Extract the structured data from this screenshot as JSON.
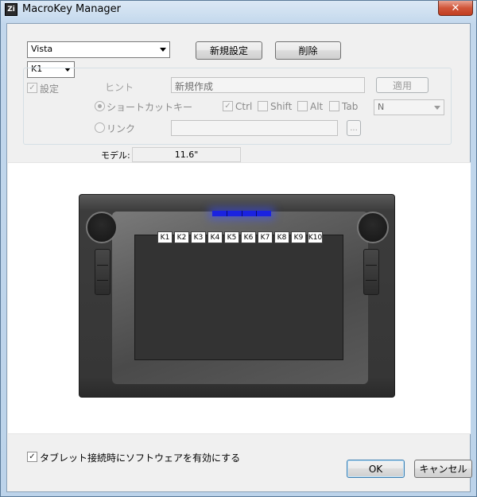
{
  "window": {
    "title": "MacroKey Manager",
    "icon_text": "Zi",
    "close_symbol": "✕"
  },
  "top": {
    "os_select": "Vista",
    "new_button": "新規設定",
    "delete_button": "削除",
    "key_select": "K1"
  },
  "macro": {
    "enable_label": "設定",
    "hint_label": "ヒント",
    "hint_value": "新規作成",
    "apply_button": "適用",
    "shortcut_label": "ショートカットキー",
    "modifiers": [
      {
        "label": "Ctrl",
        "checked": true
      },
      {
        "label": "Shift",
        "checked": false
      },
      {
        "label": "Alt",
        "checked": false
      },
      {
        "label": "Tab",
        "checked": false
      }
    ],
    "key_value": "N",
    "link_label": "リンク",
    "link_value": "",
    "browse_button": "..."
  },
  "model": {
    "label": "モデル:",
    "value": "11.6\""
  },
  "tablet": {
    "keys": [
      "K1",
      "K2",
      "K3",
      "K4",
      "K5",
      "K6",
      "K7",
      "K8",
      "K9",
      "K10"
    ]
  },
  "footer": {
    "startup_label": "タブレット接続時にソフトウェアを有効にする",
    "startup_checked": true,
    "ok_button": "OK",
    "cancel_button": "キャンセル"
  }
}
